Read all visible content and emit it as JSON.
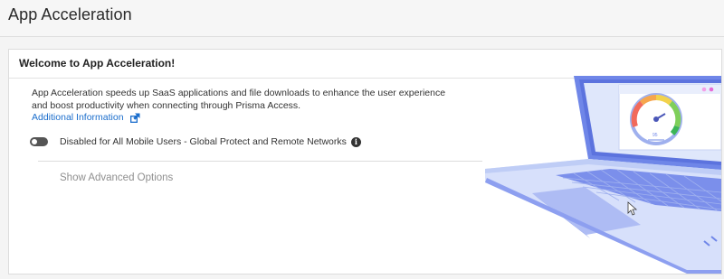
{
  "page": {
    "title": "App Acceleration"
  },
  "card": {
    "title": "Welcome to App Acceleration!",
    "description": "App Acceleration speeds up SaaS applications and file downloads to enhance the user experience and boost productivity when connecting through Prisma Access.",
    "link_label": "Additional Information",
    "link_icon": "external-link-icon",
    "toggle": {
      "state": "off",
      "label": "Disabled for All Mobile Users - Global Protect and Remote Networks",
      "info_icon": "info-icon"
    },
    "advanced_label": "Show Advanced Options"
  },
  "illustration": {
    "name": "laptop-speedometer-illustration"
  },
  "colors": {
    "link": "#1a6dcc",
    "muted": "#8f8f8f",
    "toggle_off": "#555555",
    "illustration_blue": "#6f86e8"
  }
}
